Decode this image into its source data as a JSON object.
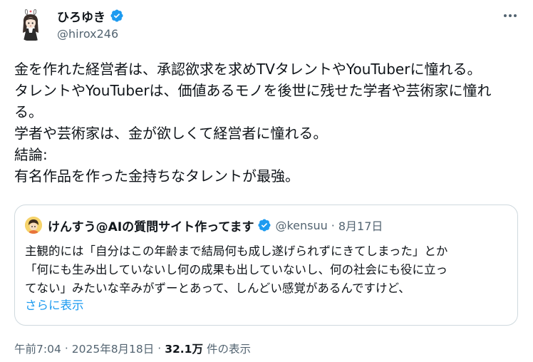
{
  "author": {
    "name": "ひろゆき",
    "handle": "@hirox246",
    "verified_color": "#1d9bf0"
  },
  "tweet": {
    "lines": [
      "金を作れた経営者は、承認欲求を求めTVタレントやYouTuberに憧れる。",
      "タレントやYouTuberは、価値あるモノを後世に残せた学者や芸術家に憧れ",
      "る。",
      "学者や芸術家は、金が欲しくて経営者に憧れる。",
      "結論:",
      "有名作品を作った金持ちなタレントが最強。"
    ]
  },
  "quote": {
    "name": "けんすう@AIの質問サイト作ってます",
    "handle": "@kensuu",
    "separator": "·",
    "date": "8月17日",
    "lines": [
      "主観的には「自分はこの年齢まで結局何も成し遂げられずにきてしまった」とか",
      "「何にも生み出していないし何の成果も出していないし、何の社会にも役に立っ",
      "てない」みたいな辛みがずーとあって、しんどい感覚があるんですけど、"
    ],
    "show_more": "さらに表示"
  },
  "meta": {
    "time": "午前7:04",
    "separator": "·",
    "date": "2025年8月18日",
    "separator2": "·",
    "views": "32.1万",
    "views_label": "件の表示"
  },
  "icons": {
    "more": "more-horizontal-icon",
    "verified": "verified-badge-icon"
  }
}
